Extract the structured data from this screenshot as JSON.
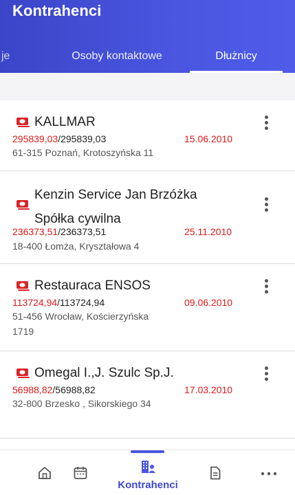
{
  "appbar": {
    "title": "Kontrahenci"
  },
  "tabs": [
    {
      "label": "je",
      "selected": false
    },
    {
      "label": "Osoby kontaktowe",
      "selected": false
    },
    {
      "label": "Dłużnicy",
      "selected": true
    }
  ],
  "colors": {
    "primary": "#4a56e0",
    "accent_red": "#e01a1a",
    "icon_red": "#d8232a"
  },
  "debtors": [
    {
      "name": "KALLMAR",
      "amount_paid": "295839,03",
      "amount_total": "/295839,03",
      "date": "15.06.2010",
      "address": "61-315 Poznań, Krotoszyńska 11",
      "icon": "money-icon"
    },
    {
      "name": "Kenzin Service Jan Brzóżka Spółka cywilna",
      "amount_paid": "236373,51",
      "amount_total": "/236373,51",
      "date": "25.11.2010",
      "address": "18-400 Łomża, Kryształowa 4",
      "icon": "money-icon"
    },
    {
      "name": "Restauraca ENSOS",
      "amount_paid": "113724,94",
      "amount_total": "/113724,94",
      "date": "09.06.2010",
      "address": "51-456 Wrocław, Kościerzyńska 1719",
      "icon": "money-icon"
    },
    {
      "name": "Omegal I.,J. Szulc Sp.J.",
      "amount_paid": "56988,82",
      "amount_total": "/56988,82",
      "date": "17.03.2010",
      "address": "32-800 Brzesko , Sikorskiego 34",
      "icon": "money-icon"
    }
  ],
  "bottom_nav": {
    "items": [
      "home-icon",
      "calendar-icon",
      "contractors-icon",
      "document-icon",
      "more-icon"
    ],
    "active_label": "Kontrahenci"
  }
}
